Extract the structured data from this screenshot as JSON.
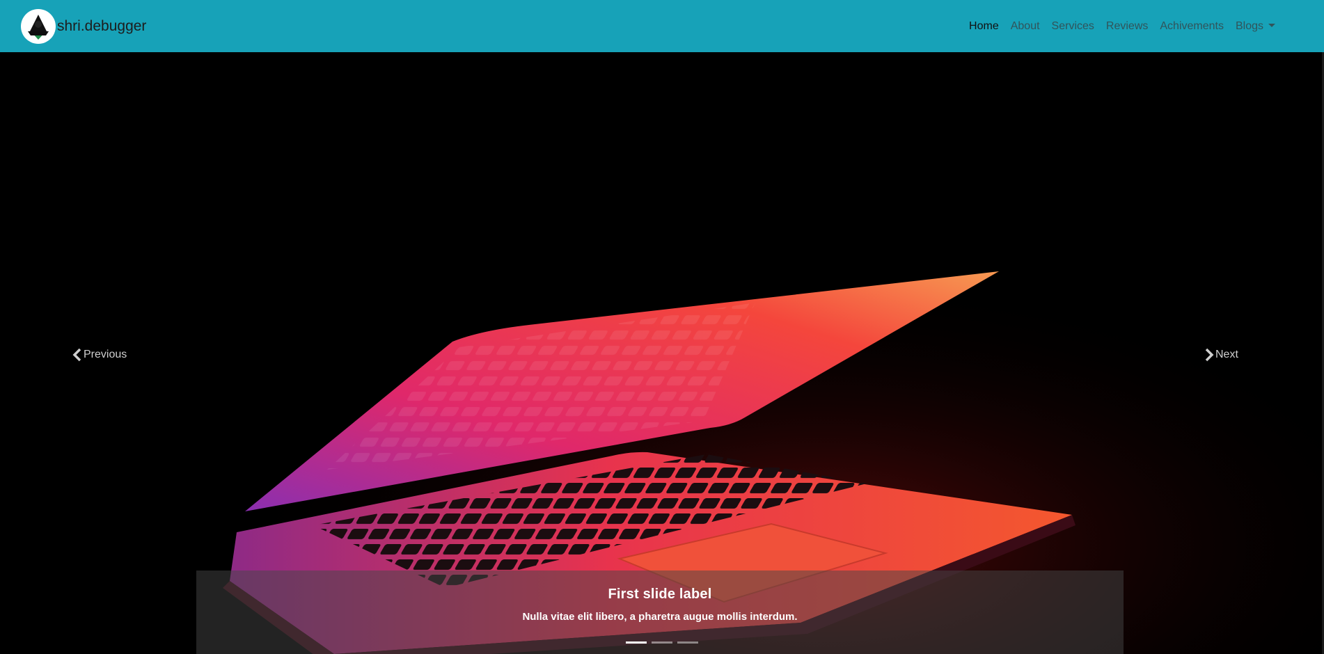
{
  "brand": {
    "name": "shri.debugger",
    "logo_icon": "hacker-avatar-icon"
  },
  "nav": {
    "items": [
      {
        "label": "Home",
        "active": true
      },
      {
        "label": "About"
      },
      {
        "label": "Services"
      },
      {
        "label": "Reviews"
      },
      {
        "label": "Achivements"
      },
      {
        "label": "Blogs",
        "dropdown": true
      }
    ]
  },
  "carousel": {
    "prev_label": "Previous",
    "next_label": "Next",
    "active_index": 0,
    "slide_count": 3,
    "caption": {
      "title": "First slide label",
      "text": "Nulla vitae elit libero, a pharetra augue mollis interdum."
    }
  },
  "colors": {
    "navbar": "#17a2b8",
    "nav_text": "#31545a",
    "background": "#000000"
  }
}
